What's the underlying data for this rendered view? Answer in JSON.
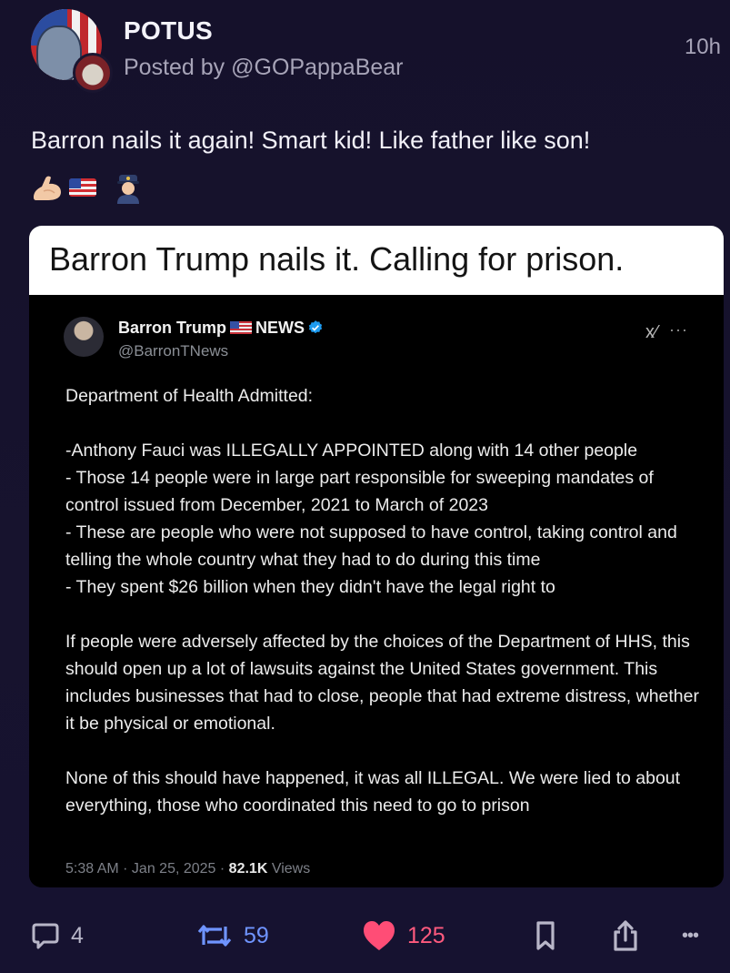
{
  "post": {
    "author": "POTUS",
    "posted_by": "Posted by @GOPappaBear",
    "time": "10h",
    "text": "Barron nails it again! Smart kid! Like father like son!",
    "emojis": [
      "flexed-biceps",
      "us-flag",
      "police-officer"
    ]
  },
  "card": {
    "title": "Barron Trump nails it. Calling for prison.",
    "tweet": {
      "name": "Barron Trump",
      "name_suffix": "NEWS",
      "handle": "@BarronTNews",
      "x_label": "x⁄",
      "menu_label": "···",
      "paragraphs": [
        "Department of Health Admitted:",
        "-Anthony Fauci was ILLEGALLY APPOINTED along with 14 other people\n- Those 14 people were in large part responsible for sweeping mandates of control issued from December, 2021 to March of 2023\n- These are people who were not supposed to have control, taking control and telling the whole country what they had to do during this time\n- They spent $26 billion when they didn't have the legal right to",
        "If people were adversely affected by the choices of the Department of HHS, this should open up a lot of lawsuits against the United States government. This includes businesses that had to close, people that had extreme distress, whether it be physical or emotional.",
        "None of this should have happened, it was all ILLEGAL. We were lied to about everything, those who coordinated this need to go to prison"
      ],
      "meta_time": "5:38 AM · Jan 25, 2025 · ",
      "views_count": "82.1K",
      "views_label": " Views"
    }
  },
  "actions": {
    "comments": "4",
    "reposts": "59",
    "likes": "125",
    "more_label": "•••"
  },
  "colors": {
    "background": "#16122d",
    "repost": "#6f94ff",
    "like": "#ff5a7e",
    "verified": "#1d9bf0"
  }
}
